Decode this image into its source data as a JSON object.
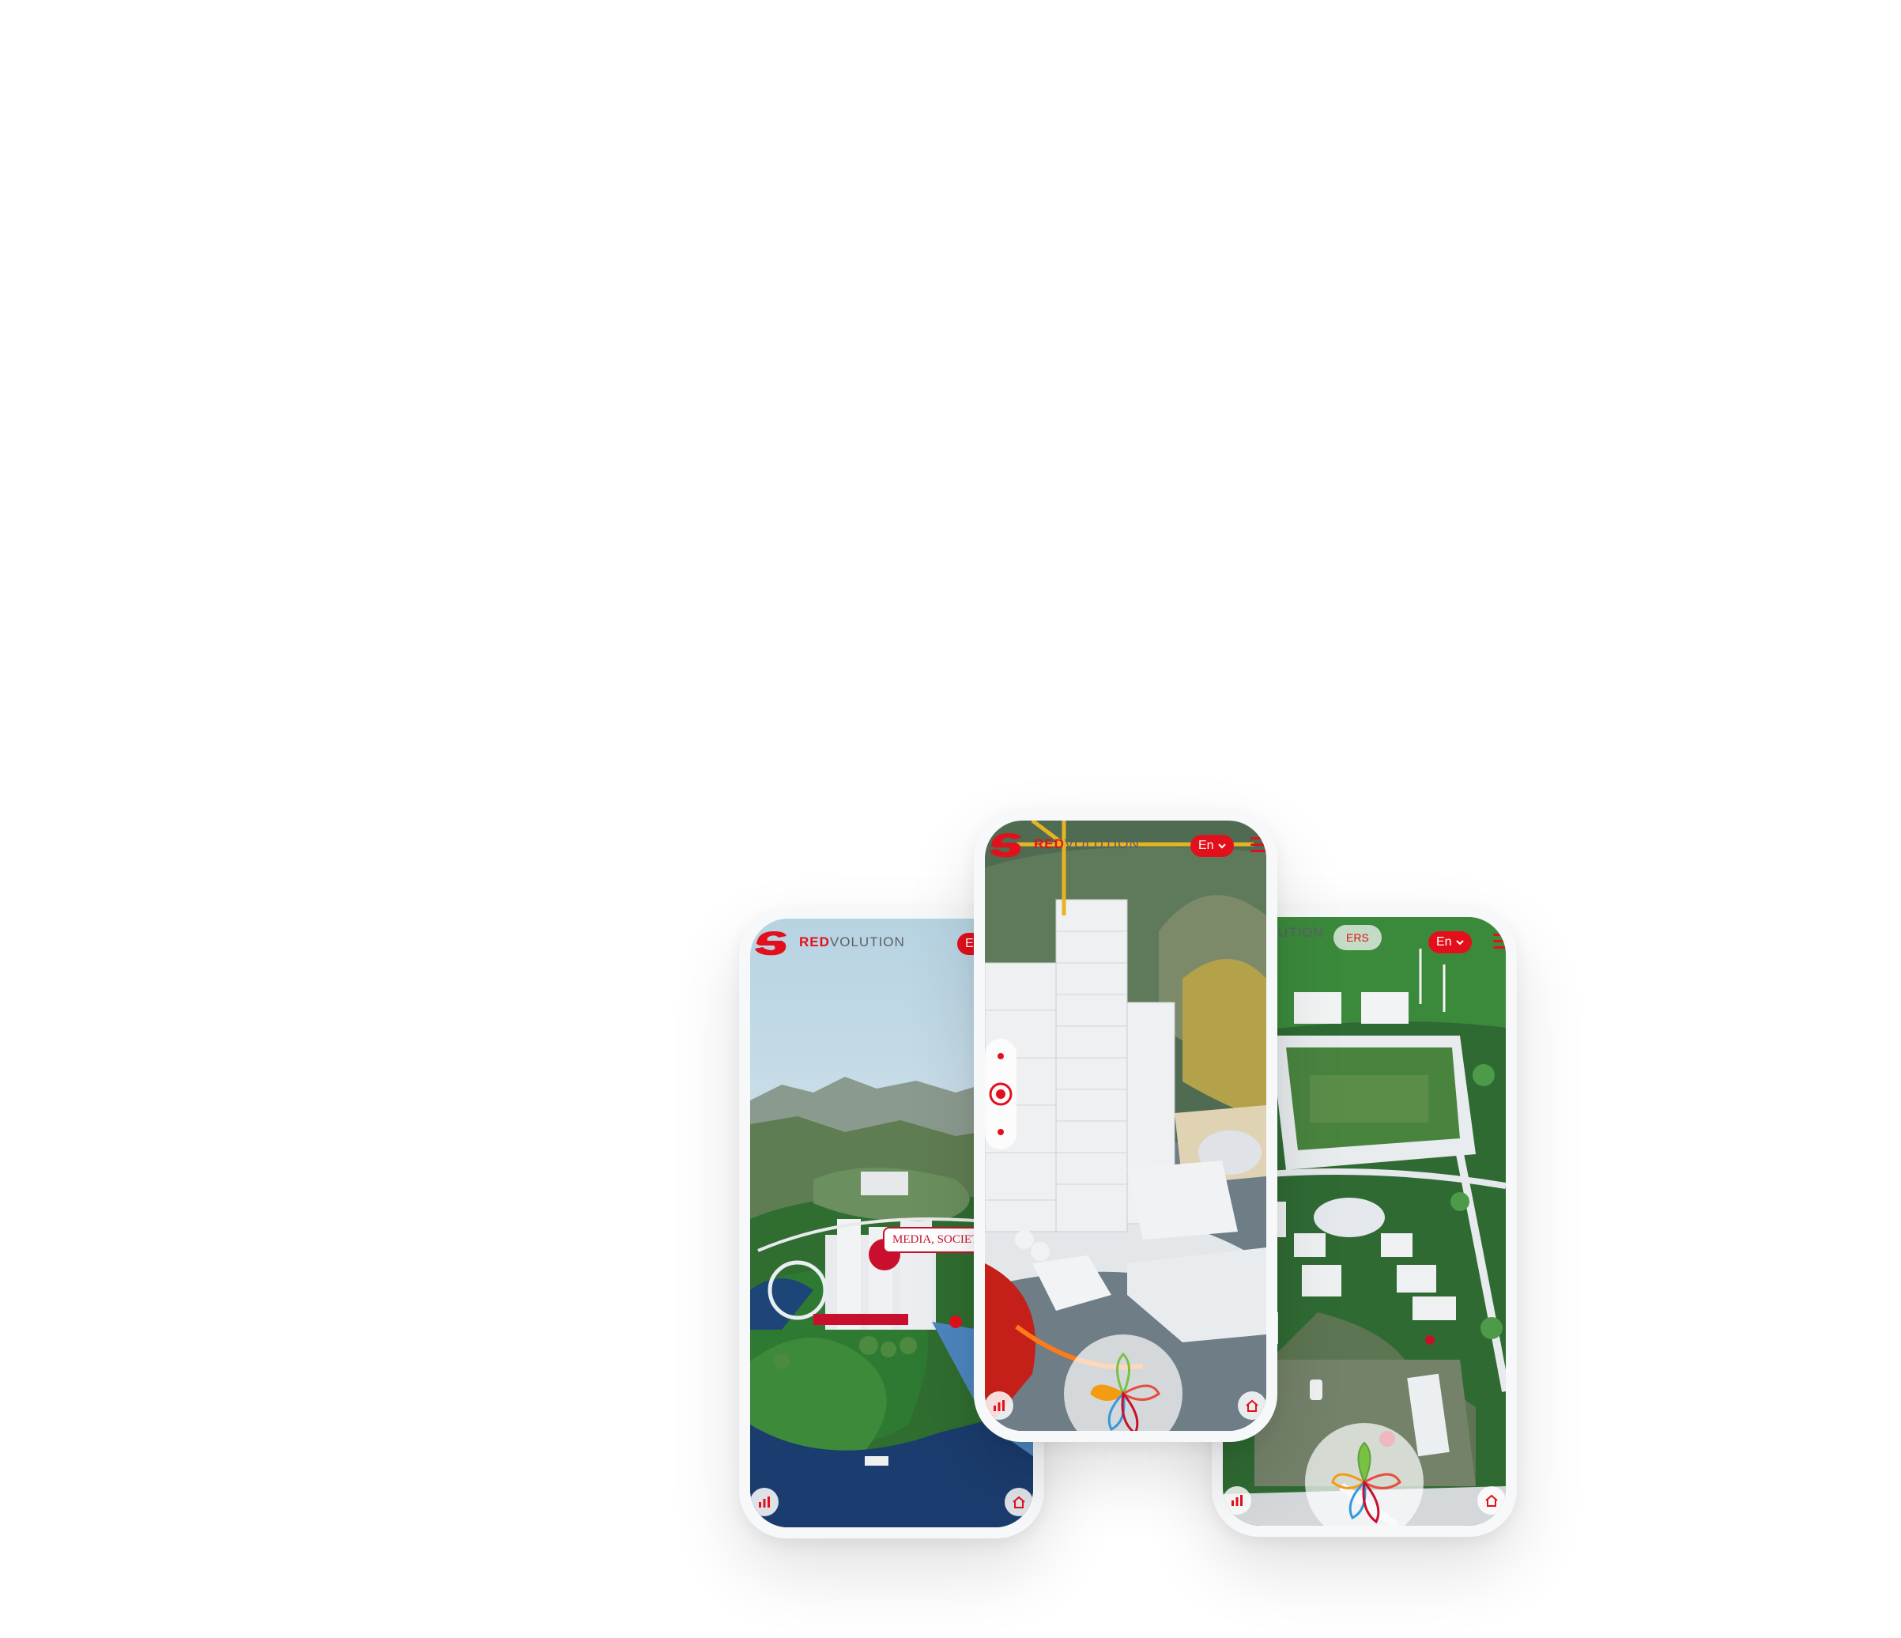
{
  "brand": {
    "name_red": "RED",
    "name_grey": "VOLUTION"
  },
  "phones": {
    "left": {
      "lang": "En",
      "label": "MEDIA, SOCIETY &"
    },
    "center": {
      "lang": "En"
    },
    "right": {
      "lang": "En",
      "chip": "ERS"
    }
  },
  "colors": {
    "accent": "#e3101b",
    "sky": "#cfe3ee",
    "water": "#1b3c6e",
    "grass": "#2f7a32"
  },
  "icons": [
    "logo-icon",
    "chevron-down-icon",
    "menu-icon",
    "stats-icon",
    "home-icon",
    "flower-icon"
  ]
}
